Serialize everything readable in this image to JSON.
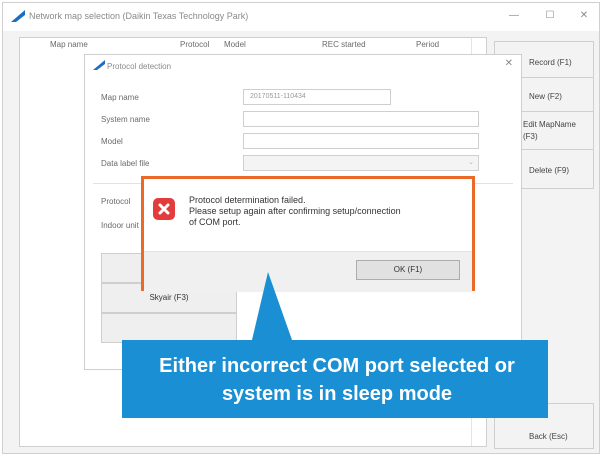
{
  "window": {
    "title": "Network map selection (Daikin Texas Technology Park)",
    "minimize_glyph": "—",
    "maximize_glyph": "☐",
    "close_glyph": "✕"
  },
  "table": {
    "headers": [
      "Map name",
      "Protocol",
      "Model",
      "REC started",
      "Period"
    ]
  },
  "side_buttons": {
    "record": "Record (F1)",
    "new": "New (F2)",
    "edit_line1": "Edit MapName",
    "edit_line2": "(F3)",
    "delete": "Delete (F9)",
    "back": "Back (Esc)"
  },
  "protocol_dialog": {
    "title": "Protocol detection",
    "close_glyph": "✕",
    "fields": {
      "map_name_label": "Map name",
      "map_name_value": "20170511-110434",
      "system_name_label": "System name",
      "model_label": "Model",
      "data_label_file_label": "Data label file",
      "protocol_label": "Protocol",
      "indoor_unit_label": "Indoor unit"
    },
    "buttons": {
      "skyair": "Skyair (F3)"
    }
  },
  "error_dialog": {
    "line1": "Protocol determination failed.",
    "line2": "Please setup again after confirming setup/connection",
    "line3": "of COM port.",
    "ok_label": "OK (F1)"
  },
  "callout": {
    "line1": "Either incorrect COM port selected or",
    "line2": "system is in sleep mode"
  },
  "colors": {
    "callout_blue": "#1a8fd4",
    "error_border": "#ec6a29",
    "error_icon": "#e23c3c",
    "brand_blue": "#1b6ec2"
  }
}
